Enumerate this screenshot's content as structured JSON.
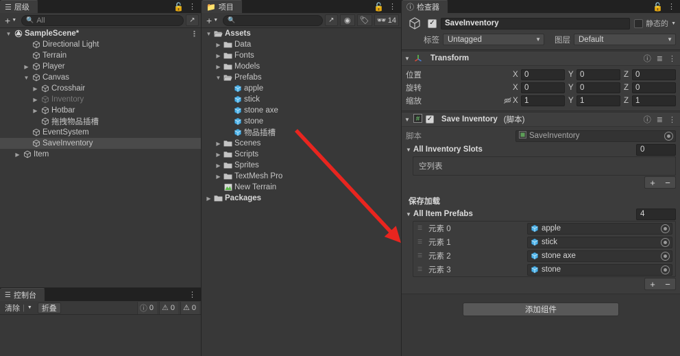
{
  "hierarchy": {
    "tab_label": "层级",
    "tab_icon": "hierarchy-icon",
    "toolbar": {
      "add_label": "+",
      "search_placeholder": "All",
      "search_value": "All"
    },
    "items": [
      {
        "label": "SampleScene*",
        "depth": 0,
        "arrow": "down",
        "icon": "unity-scene-icon",
        "bold": true,
        "selected": false,
        "dim": false,
        "menu": "⋮"
      },
      {
        "label": "Directional Light",
        "depth": 2,
        "arrow": "none",
        "icon": "gameobject-icon",
        "bold": false,
        "selected": false,
        "dim": false
      },
      {
        "label": "Terrain",
        "depth": 2,
        "arrow": "none",
        "icon": "gameobject-icon",
        "bold": false,
        "selected": false,
        "dim": false
      },
      {
        "label": "Player",
        "depth": 2,
        "arrow": "right",
        "icon": "gameobject-icon",
        "bold": false,
        "selected": false,
        "dim": false
      },
      {
        "label": "Canvas",
        "depth": 2,
        "arrow": "down",
        "icon": "gameobject-icon",
        "bold": false,
        "selected": false,
        "dim": false
      },
      {
        "label": "Crosshair",
        "depth": 3,
        "arrow": "right",
        "icon": "gameobject-icon",
        "bold": false,
        "selected": false,
        "dim": false
      },
      {
        "label": "Inventory",
        "depth": 3,
        "arrow": "right",
        "icon": "gameobject-icon",
        "bold": false,
        "selected": false,
        "dim": true
      },
      {
        "label": "Hotbar",
        "depth": 3,
        "arrow": "right",
        "icon": "gameobject-icon",
        "bold": false,
        "selected": false,
        "dim": false
      },
      {
        "label": "拖拽物品插槽",
        "depth": 3,
        "arrow": "none",
        "icon": "gameobject-icon",
        "bold": false,
        "selected": false,
        "dim": false
      },
      {
        "label": "EventSystem",
        "depth": 2,
        "arrow": "none",
        "icon": "gameobject-icon",
        "bold": false,
        "selected": false,
        "dim": false
      },
      {
        "label": "SaveInventory",
        "depth": 2,
        "arrow": "none",
        "icon": "gameobject-icon",
        "bold": false,
        "selected": true,
        "dim": false
      },
      {
        "label": "Item",
        "depth": 1,
        "arrow": "right",
        "icon": "gameobject-icon",
        "bold": false,
        "selected": false,
        "dim": false
      }
    ]
  },
  "console": {
    "tab_label": "控制台",
    "tab_icon": "console-icon",
    "clear_label": "清除",
    "collapse_label": "折叠",
    "counts": {
      "log": "0",
      "warning": "0",
      "error": "0"
    }
  },
  "project": {
    "tab_label": "项目",
    "tab_icon": "folder-icon",
    "toolbar": {
      "add_label": "+",
      "search_placeholder": "",
      "favorite_count": "14"
    },
    "items": [
      {
        "label": "Assets",
        "depth": 0,
        "arrow": "down",
        "icon": "folder-open-icon",
        "bold": true
      },
      {
        "label": "Data",
        "depth": 1,
        "arrow": "right",
        "icon": "folder-icon",
        "bold": false
      },
      {
        "label": "Fonts",
        "depth": 1,
        "arrow": "right",
        "icon": "folder-icon",
        "bold": false
      },
      {
        "label": "Models",
        "depth": 1,
        "arrow": "right",
        "icon": "folder-icon",
        "bold": false
      },
      {
        "label": "Prefabs",
        "depth": 1,
        "arrow": "down",
        "icon": "folder-open-icon",
        "bold": false
      },
      {
        "label": "apple",
        "depth": 2,
        "arrow": "none",
        "icon": "prefab-icon",
        "bold": false
      },
      {
        "label": "stick",
        "depth": 2,
        "arrow": "none",
        "icon": "prefab-icon",
        "bold": false
      },
      {
        "label": "stone axe",
        "depth": 2,
        "arrow": "none",
        "icon": "prefab-icon",
        "bold": false
      },
      {
        "label": "stone",
        "depth": 2,
        "arrow": "none",
        "icon": "prefab-icon",
        "bold": false
      },
      {
        "label": "物品插槽",
        "depth": 2,
        "arrow": "none",
        "icon": "prefab-icon",
        "bold": false
      },
      {
        "label": "Scenes",
        "depth": 1,
        "arrow": "right",
        "icon": "folder-icon",
        "bold": false
      },
      {
        "label": "Scripts",
        "depth": 1,
        "arrow": "right",
        "icon": "folder-icon",
        "bold": false
      },
      {
        "label": "Sprites",
        "depth": 1,
        "arrow": "right",
        "icon": "folder-icon",
        "bold": false
      },
      {
        "label": "TextMesh Pro",
        "depth": 1,
        "arrow": "right",
        "icon": "folder-icon",
        "bold": false
      },
      {
        "label": "New Terrain",
        "depth": 1,
        "arrow": "none",
        "icon": "terrain-asset-icon",
        "bold": false
      },
      {
        "label": "Packages",
        "depth": 0,
        "arrow": "right",
        "icon": "folder-icon",
        "bold": true
      }
    ]
  },
  "inspector": {
    "tab_label": "检查器",
    "tab_icon": "info-icon",
    "object": {
      "enabled": true,
      "name": "SaveInventory",
      "static_label": "静态的",
      "static_checked": false,
      "tag_label": "标签",
      "tag_value": "Untagged",
      "layer_label": "图层",
      "layer_value": "Default"
    },
    "transform": {
      "title": "Transform",
      "rows": [
        {
          "label": "位置",
          "x": "0",
          "y": "0",
          "z": "0",
          "link": false
        },
        {
          "label": "旋转",
          "x": "0",
          "y": "0",
          "z": "0",
          "link": false
        },
        {
          "label": "缩放",
          "x": "1",
          "y": "1",
          "z": "1",
          "link": true
        }
      ],
      "axes": [
        "X",
        "Y",
        "Z"
      ]
    },
    "script_component": {
      "title": "Save Inventory",
      "subtitle": "(脚本)",
      "enabled": true,
      "script_field_label": "脚本",
      "script_field_value": "SaveInventory",
      "slots_array": {
        "title": "All Inventory Slots",
        "size": "0",
        "empty_text": "空列表"
      },
      "section_label": "保存加载",
      "prefabs_array": {
        "title": "All Item Prefabs",
        "size": "4",
        "elements": [
          {
            "label": "元素 0",
            "value": "apple"
          },
          {
            "label": "元素 1",
            "value": "stick"
          },
          {
            "label": "元素 2",
            "value": "stone axe"
          },
          {
            "label": "元素 3",
            "value": "stone"
          }
        ]
      }
    },
    "add_component_label": "添加组件"
  },
  "annotation": {
    "arrow_color": "#e8251f",
    "from": [
      432,
      190
    ],
    "to": [
      584,
      353
    ]
  }
}
